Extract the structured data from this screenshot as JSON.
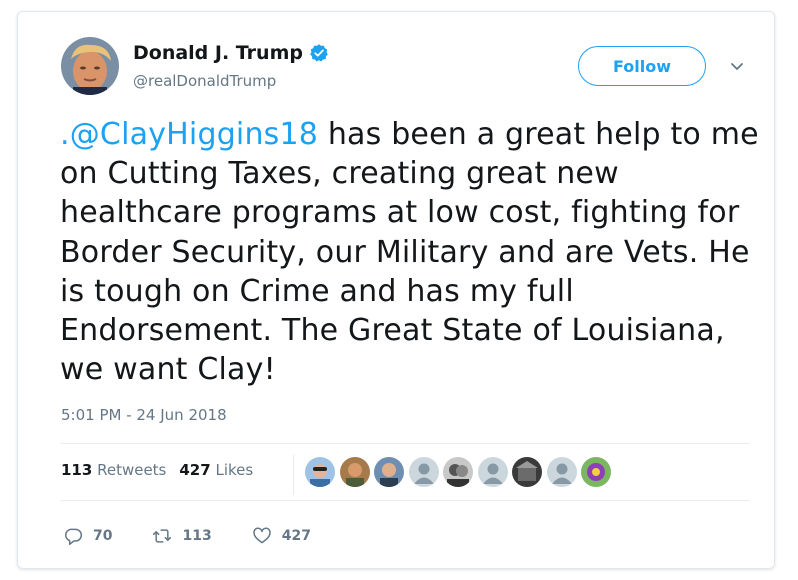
{
  "tweet": {
    "author_name": "Donald J. Trump",
    "author_handle": "@realDonaldTrump",
    "follow_label": "Follow",
    "mention": ".@ClayHiggins18",
    "text_rest": " has been a great help to me on Cutting Taxes, creating great new healthcare programs at low cost, fighting for Border Security, our Military and are Vets. He is tough on Crime and has my full Endorsement. The Great State of Louisiana, we want Clay!",
    "timestamp": "5:01 PM - 24 Jun 2018"
  },
  "stats": {
    "retweets_count": "113",
    "retweets_label": "Retweets",
    "likes_count": "427",
    "likes_label": "Likes"
  },
  "actions": {
    "reply_count": "70",
    "retweet_count": "113",
    "like_count": "427"
  },
  "colors": {
    "accent": "#1da1f2",
    "secondary_text": "#657786",
    "divider": "#e6ecf0"
  },
  "icons": [
    "verified-badge-icon",
    "chevron-down-icon",
    "reply-icon",
    "retweet-icon",
    "heart-icon"
  ]
}
